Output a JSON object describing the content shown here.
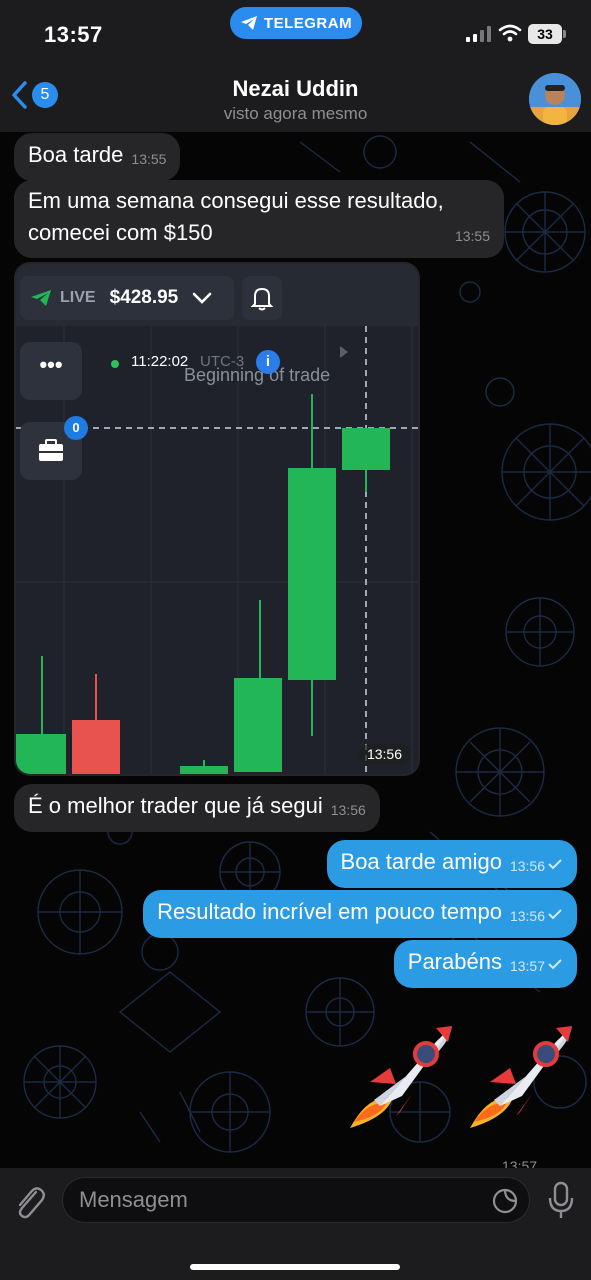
{
  "status_bar": {
    "time": "13:57",
    "app_pill": "TELEGRAM",
    "battery": "33",
    "icons": [
      "signal-icon",
      "wifi-icon",
      "battery-icon"
    ]
  },
  "header": {
    "back_count": "5",
    "name": "Nezai Uddin",
    "status": "visto agora mesmo",
    "icons": [
      "chevron-left-icon",
      "avatar"
    ]
  },
  "messages": {
    "m1": {
      "text": "Boa tarde",
      "time": "13:55"
    },
    "m2": {
      "line1": "Em uma semana consegui esse resultado,",
      "line2": "comecei com $150",
      "time": "13:55"
    },
    "photo": {
      "live_label": "LIVE",
      "balance": "$428.95",
      "menu_dots": "•••",
      "portfolio_badge": "0",
      "clock": "11:22:02",
      "utc": "UTC-3",
      "marker": "Beginning of trade",
      "info": "i",
      "time": "13:56",
      "icons": [
        "paper-plane-icon",
        "chevron-down-icon",
        "bell-icon",
        "briefcase-icon",
        "play-icon"
      ],
      "colors": {
        "up": "#22b657",
        "down": "#e9534f",
        "bg": "#1f222b"
      }
    },
    "m3": {
      "text": "É o melhor trader que já segui",
      "time": "13:56"
    },
    "m4": {
      "text": "Boa tarde amigo",
      "time": "13:56"
    },
    "m5": {
      "text": "Resultado incrível em pouco tempo",
      "time": "13:56"
    },
    "m6": {
      "text": "Parabéns",
      "time": "13:57"
    },
    "stickers": {
      "time": "13:57",
      "icons": [
        "rocket-icon",
        "rocket-icon"
      ]
    }
  },
  "input": {
    "placeholder": "Mensagem",
    "icons": [
      "paperclip-icon",
      "sticker-icon",
      "microphone-icon"
    ]
  },
  "colors": {
    "accent": "#2b8cf0",
    "outgoing_bubble": "#2b9be3",
    "incoming_bubble": "#262628"
  }
}
